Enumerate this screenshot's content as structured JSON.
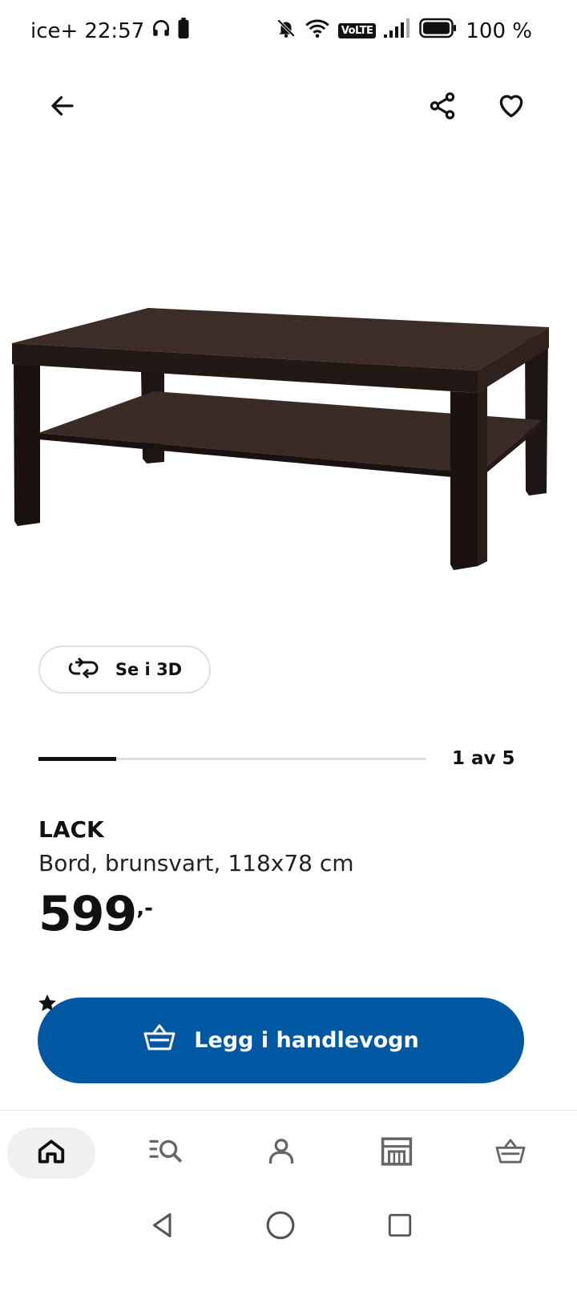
{
  "status_bar": {
    "carrier": "ice+",
    "time": "22:57",
    "battery_percent": "100 %",
    "volte": "VoLTE"
  },
  "top_bar": {
    "icons": [
      "arrow-left-icon",
      "share-icon",
      "heart-icon"
    ]
  },
  "gallery": {
    "see_3d_label": "Se i 3D",
    "counter": "1 av 5",
    "current_index": 1,
    "total": 5
  },
  "product": {
    "name": "LACK",
    "description": "Bord, brunsvart, 118x78 cm",
    "price_integer": "599",
    "price_suffix": ",-"
  },
  "actions": {
    "add_to_cart_label": "Legg i handlevogn"
  },
  "bottom_nav": {
    "items": [
      "home-icon",
      "search-list-icon",
      "profile-icon",
      "store-icon",
      "cart-icon"
    ],
    "active": "home-icon"
  },
  "colors": {
    "accent_blue": "#0058a3",
    "table_color": "#2b1f1c"
  }
}
